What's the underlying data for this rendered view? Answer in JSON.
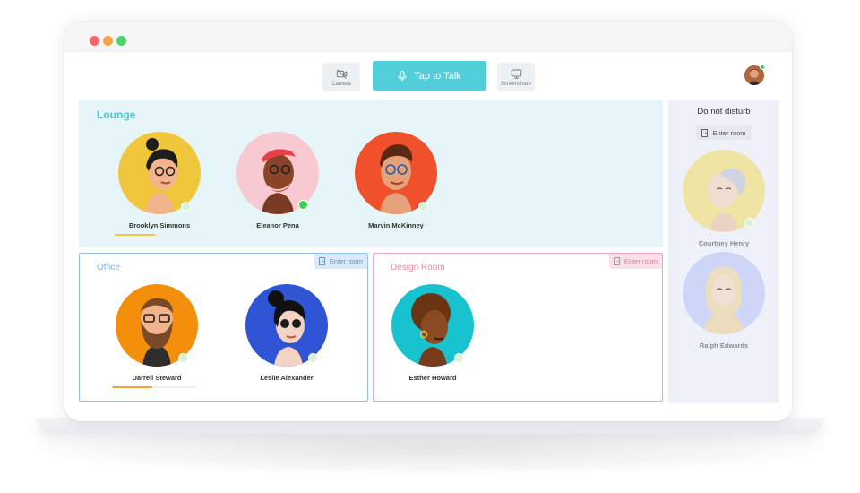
{
  "colors": {
    "accent": "#52ced9",
    "lounge_bg": "#e6f6f8",
    "office_border": "#8fc3e8",
    "design_border": "#eea6bf",
    "online": "#3ccf58"
  },
  "toolbar": {
    "camera_label": "Camera",
    "camera_icon": "video-off-icon",
    "talk_label": "Tap to Talk",
    "talk_icon": "microphone-icon",
    "screenshare_label": "Screenshare",
    "screenshare_icon": "monitor-icon"
  },
  "lounge": {
    "title": "Lounge",
    "people": [
      {
        "name": "Brooklyn Simmons",
        "bg": "#f0c73a",
        "speaking_level": 0.47
      },
      {
        "name": "Eleanor Pena",
        "bg": "#f8c9d0"
      },
      {
        "name": "Marvin McKinney",
        "bg": "#f0502c"
      }
    ]
  },
  "office": {
    "title": "Office",
    "enter_label": "Enter room",
    "people": [
      {
        "name": "Darrell Steward",
        "bg": "#f48f0c",
        "speaking_level": 0.47
      },
      {
        "name": "Leslie Alexander",
        "bg": "#2f55d4"
      }
    ]
  },
  "design": {
    "title": "Design Room",
    "enter_label": "Enter room",
    "people": [
      {
        "name": "Esther Howard",
        "bg": "#18c3cf"
      }
    ]
  },
  "dnd": {
    "title": "Do not disturb",
    "enter_label": "Enter room",
    "people": [
      {
        "name": "Courtney Henry",
        "bg": "#f1e08a"
      },
      {
        "name": "Ralph Edwards",
        "bg": "#c5ccf6"
      }
    ]
  }
}
